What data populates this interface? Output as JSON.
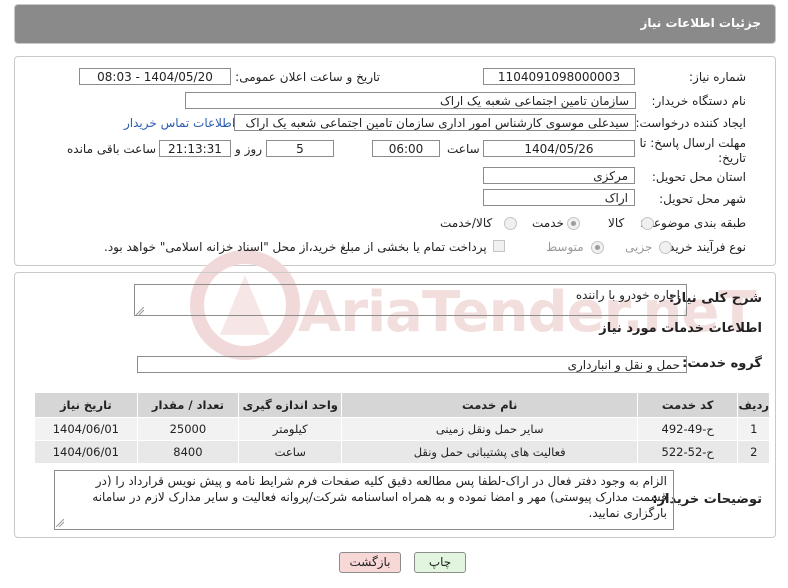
{
  "header": {
    "title": "جزئیات اطلاعات نیاز"
  },
  "watermark": {
    "text": "AriaTender.neT"
  },
  "fields": {
    "need_number_label": "شماره نیاز:",
    "need_number": "1104091098000003",
    "announce_label": "تاریخ و ساعت اعلان عمومی:",
    "announce_value": "1404/05/20 - 08:03",
    "buyer_org_label": "نام دستگاه خریدار:",
    "buyer_org": "سازمان تامین اجتماعی شعبه یک اراک",
    "creator_label": "ایجاد کننده درخواست:",
    "creator": "سیدعلی موسوی کارشناس امور اداری سازمان تامین اجتماعی شعبه یک اراک",
    "contact_link": "اطلاعات تماس خریدار",
    "deadline_label_1": "مهلت ارسال پاسخ: تا",
    "deadline_label_2": "تاریخ:",
    "deadline_date": "1404/05/26",
    "time_label": "ساعت",
    "deadline_time": "06:00",
    "days": "5",
    "days_label": "روز و",
    "remaining_time": "21:13:31",
    "remaining_label": "ساعت باقی مانده",
    "province_label": "استان محل تحویل:",
    "province": "مرکزی",
    "city_label": "شهر محل تحویل:",
    "city": "اراک",
    "category_label": "طبقه بندی موضوعی:",
    "category_options": [
      "کالا",
      "خدمت",
      "کالا/خدمت"
    ],
    "category_selected": "خدمت",
    "purchase_type_label": "نوع فرآیند خرید :",
    "purchase_options": [
      "جزیی",
      "متوسط"
    ],
    "purchase_selected": "متوسط",
    "treasury_note": "پرداخت تمام یا بخشی از مبلغ خرید،از محل \"اسناد خزانه اسلامی\" خواهد بود."
  },
  "summary": {
    "label": "شرح کلی نیاز:",
    "value": "اجاره خودرو با راننده"
  },
  "services": {
    "section_title": "اطلاعات خدمات مورد نیاز",
    "group_label": "گروه خدمت:",
    "group_value": "حمل و نقل و انبارداری",
    "columns": [
      "ردیف",
      "کد خدمت",
      "نام خدمت",
      "واحد اندازه گیری",
      "تعداد / مقدار",
      "تاریخ نیاز"
    ],
    "rows": [
      {
        "row": "1",
        "code": "ح-49-492",
        "name": "سایر حمل ونقل زمینی",
        "unit": "کیلومتر",
        "qty": "25000",
        "date": "1404/06/01"
      },
      {
        "row": "2",
        "code": "ح-52-522",
        "name": "فعالیت های پشتیبانی حمل ونقل",
        "unit": "ساعت",
        "qty": "8400",
        "date": "1404/06/01"
      }
    ]
  },
  "buyer_notes": {
    "label": "توضیحات خریدار:",
    "value": "الزام به وجود دفتر فعال در اراک-لطفا پس مطالعه دقیق کلیه صفحات فرم شرایط نامه و پیش نویس قرارداد را (در قسمت مدارک پیوستی) مهر و امضا نموده و به همراه اساسنامه شرکت/پروانه فعالیت و سایر مدارک لازم در سامانه بارگزاری نمایید."
  },
  "buttons": {
    "print": "چاپ",
    "back": "بازگشت"
  },
  "colors": {
    "header": "#8a8a8a",
    "back_button": "#f8d7d7",
    "print_button": "#e2f5de",
    "link": "#2a5db0"
  }
}
